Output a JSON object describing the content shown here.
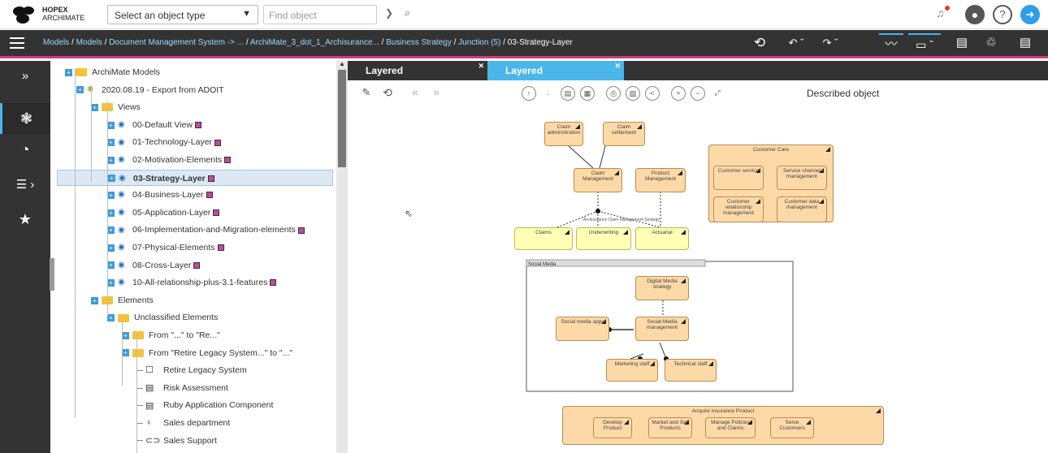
{
  "brand": {
    "line1": "HOPEX",
    "line2": "ARCHIMATE"
  },
  "top": {
    "type_select": "Select an object type",
    "find_placeholder": "Find object"
  },
  "breadcrumb": [
    {
      "label": "Models",
      "cur": false
    },
    {
      "label": "Models",
      "cur": false
    },
    {
      "label": "Document Management System -> ...",
      "cur": false
    },
    {
      "label": "ArchiMate_3_dot_1_Archisurance...",
      "cur": false
    },
    {
      "label": "Business Strategy",
      "cur": false
    },
    {
      "label": "Junction (5)",
      "cur": false
    },
    {
      "label": "03-Strategy-Layer",
      "cur": true
    }
  ],
  "tree": [
    {
      "label": "ArchiMate Models",
      "kind": "folder",
      "level": 0,
      "mark": false,
      "selected": false
    },
    {
      "label": "2020.08.19 - Export from ADOIT",
      "kind": "model",
      "level": 1,
      "mark": false,
      "selected": false
    },
    {
      "label": "Views",
      "kind": "folder",
      "level": 2,
      "mark": false,
      "selected": false
    },
    {
      "label": "00-Default View",
      "kind": "view",
      "level": 3,
      "mark": true,
      "selected": false
    },
    {
      "label": "01-Technology-Layer",
      "kind": "view",
      "level": 3,
      "mark": true,
      "selected": false
    },
    {
      "label": "02-Motivation-Elements",
      "kind": "view",
      "level": 3,
      "mark": true,
      "selected": false
    },
    {
      "label": "03-Strategy-Layer",
      "kind": "view",
      "level": 3,
      "mark": true,
      "selected": true
    },
    {
      "label": "04-Business-Layer",
      "kind": "view",
      "level": 3,
      "mark": true,
      "selected": false
    },
    {
      "label": "05-Application-Layer",
      "kind": "view",
      "level": 3,
      "mark": true,
      "selected": false
    },
    {
      "label": "06-Implementation-and-Migration-elements",
      "kind": "view",
      "level": 3,
      "mark": true,
      "selected": false
    },
    {
      "label": "07-Physical-Elements",
      "kind": "view",
      "level": 3,
      "mark": true,
      "selected": false
    },
    {
      "label": "08-Cross-Layer",
      "kind": "view",
      "level": 3,
      "mark": true,
      "selected": false
    },
    {
      "label": "10-All-relationship-plus-3.1-features",
      "kind": "view",
      "level": 3,
      "mark": true,
      "selected": false
    },
    {
      "label": "Elements",
      "kind": "folder",
      "level": 2,
      "mark": false,
      "selected": false
    },
    {
      "label": "Unclassified Elements",
      "kind": "folder",
      "level": 3,
      "mark": false,
      "selected": false
    },
    {
      "label": "From \"...\" to \"Re...\"",
      "kind": "folder",
      "level": 4,
      "mark": false,
      "selected": false
    },
    {
      "label": "From \"Retire Legacy System...\" to \"...\"",
      "kind": "folder",
      "level": 4,
      "mark": false,
      "selected": false
    },
    {
      "label": "Retire Legacy System",
      "kind": "item",
      "icon": "☐",
      "level": 5,
      "mark": false,
      "selected": false
    },
    {
      "label": "Risk Assessment",
      "kind": "item",
      "icon": "▤",
      "level": 5,
      "mark": false,
      "selected": false
    },
    {
      "label": "Ruby Application Component",
      "kind": "item",
      "icon": "▤",
      "level": 5,
      "mark": false,
      "selected": false
    },
    {
      "label": "Sales department",
      "kind": "item",
      "icon": "♀",
      "level": 5,
      "mark": false,
      "selected": false
    },
    {
      "label": "Sales Support",
      "kind": "item",
      "icon": "⊂⊃",
      "level": 5,
      "mark": false,
      "selected": false
    }
  ],
  "tabs": [
    "Layered",
    "Layered"
  ],
  "toolbar": {
    "described": "Described object"
  },
  "diagram": {
    "elements": [
      {
        "text": "Claim administration",
        "cls": "el"
      },
      {
        "text": "Claim settlement",
        "cls": "el"
      },
      {
        "text": "Claim Management",
        "cls": "el"
      },
      {
        "text": "Product Management",
        "cls": "el"
      },
      {
        "text": "Claims",
        "cls": "el y"
      },
      {
        "text": "Underwriting",
        "cls": "el y"
      },
      {
        "text": "Actuarial",
        "cls": "el y"
      },
      {
        "text": "Customer Care",
        "cls": "el"
      },
      {
        "text": "Customer service",
        "cls": "el"
      },
      {
        "text": "Service channel management",
        "cls": "el"
      },
      {
        "text": "Customer relationship management",
        "cls": "el"
      },
      {
        "text": "Customer data management",
        "cls": "el"
      },
      {
        "text": "Digital Media strategy",
        "cls": "el"
      },
      {
        "text": "Social media apps",
        "cls": "el"
      },
      {
        "text": "Social Media management",
        "cls": "el"
      },
      {
        "text": "Marketing staff",
        "cls": "el"
      },
      {
        "text": "Technical staff",
        "cls": "el"
      },
      {
        "text": "Acquire Insurance Product",
        "cls": "el"
      },
      {
        "text": "Develop Product",
        "cls": "el"
      },
      {
        "text": "Market and Sell Products",
        "cls": "el"
      },
      {
        "text": "Manage Policies and Claims",
        "cls": "el"
      },
      {
        "text": "Serve Customers",
        "cls": "el"
      }
    ],
    "group_label": "Social Media",
    "junction_label": "Archisurance Claim Management Strategy"
  }
}
